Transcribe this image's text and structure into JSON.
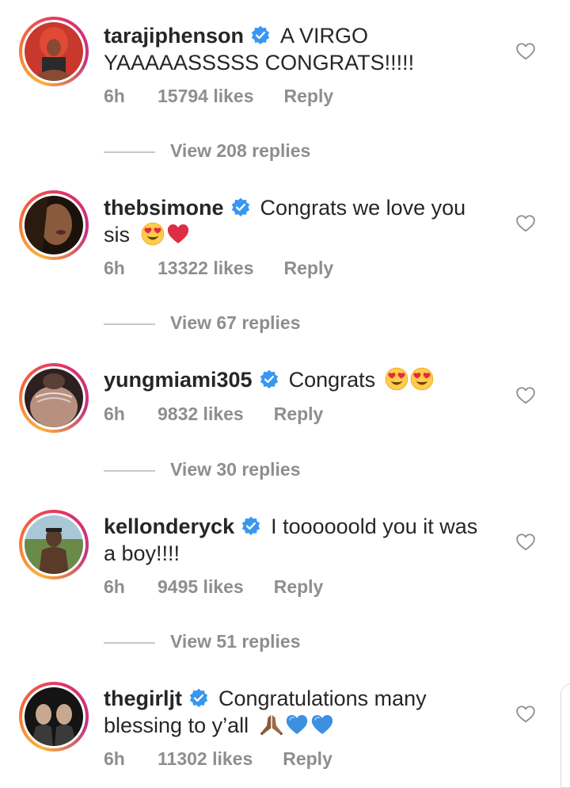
{
  "comments": [
    {
      "username": "tarajiphenson",
      "text_line1": "A VIRGO",
      "text_line2": "YAAAAASSSSS CONGRATS!!!!!",
      "time": "6h",
      "likes": "15794 likes",
      "reply": "Reply",
      "view_replies": "View 208 replies",
      "avatar_colors": [
        "#6b2a1e",
        "#c8382c",
        "#2a2a2a"
      ]
    },
    {
      "username": "thebsimone",
      "text_line1": "Congrats we love you",
      "text_line2": "sis",
      "emojis_line2": [
        "heart-eyes-emoji",
        "red-heart-emoji"
      ],
      "time": "6h",
      "likes": "13322 likes",
      "reply": "Reply",
      "view_replies": "View 67 replies",
      "avatar_colors": [
        "#3a2418",
        "#8a5a3c",
        "#1c120c"
      ]
    },
    {
      "username": "yungmiami305",
      "text_line1": "Congrats",
      "emojis_line1": [
        "heart-eyes-emoji",
        "heart-eyes-emoji"
      ],
      "time": "6h",
      "likes": "9832 likes",
      "reply": "Reply",
      "view_replies": "View 30 replies",
      "avatar_colors": [
        "#5a4036",
        "#b89080",
        "#2c2020"
      ]
    },
    {
      "username": "kellonderyck",
      "text_line1": "I toooooold you it was",
      "text_line2": "a boy!!!!",
      "time": "6h",
      "likes": "9495 likes",
      "reply": "Reply",
      "view_replies": "View 51 replies",
      "avatar_colors": [
        "#6a8a4a",
        "#a8c8d8",
        "#5a3a28"
      ]
    },
    {
      "username": "thegirljt",
      "text_line1": "Congratulations many",
      "text_line2": "blessing to y’all",
      "emojis_line2": [
        "folded-hands-emoji",
        "blue-heart-emoji",
        "blue-heart-emoji"
      ],
      "time": "6h",
      "likes": "11302 likes",
      "reply": "Reply",
      "avatar_colors": [
        "#141414",
        "#3a3a3a",
        "#c8a890"
      ]
    }
  ],
  "colors": {
    "text": "#262626",
    "muted": "#8e8e8e",
    "verified": "#3897f0",
    "ring_start": "#f9b23a",
    "ring_end": "#c13584"
  }
}
